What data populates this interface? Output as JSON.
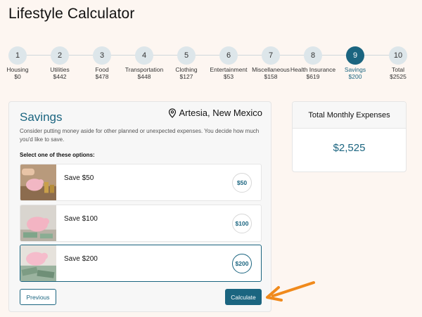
{
  "page": {
    "title": "Lifestyle Calculator"
  },
  "steps": [
    {
      "num": "1",
      "name": "Housing",
      "value": "$0"
    },
    {
      "num": "2",
      "name": "Utilities",
      "value": "$442"
    },
    {
      "num": "3",
      "name": "Food",
      "value": "$478"
    },
    {
      "num": "4",
      "name": "Transportation",
      "value": "$448"
    },
    {
      "num": "5",
      "name": "Clothing",
      "value": "$127"
    },
    {
      "num": "6",
      "name": "Entertainment",
      "value": "$53"
    },
    {
      "num": "7",
      "name": "Miscellaneous",
      "value": "$158"
    },
    {
      "num": "8",
      "name": "Health Insurance",
      "value": "$619"
    },
    {
      "num": "9",
      "name": "Savings",
      "value": "$200"
    },
    {
      "num": "10",
      "name": "Total",
      "value": "$2525"
    }
  ],
  "active_step": 9,
  "card": {
    "title": "Savings",
    "location": "Artesia, New Mexico",
    "description": "Consider putting money aside for other planned or unexpected expenses. You decide how much you'd like to save.",
    "options_label": "Select one of these options:"
  },
  "options": [
    {
      "label": "Save $50",
      "badge": "$50",
      "selected": false
    },
    {
      "label": "Save $100",
      "badge": "$100",
      "selected": false
    },
    {
      "label": "Save $200",
      "badge": "$200",
      "selected": true
    }
  ],
  "buttons": {
    "previous": "Previous",
    "calculate": "Calculate"
  },
  "summary": {
    "title": "Total Monthly Expenses",
    "value": "$2,525"
  },
  "colors": {
    "accent": "#1b6580",
    "annotation_arrow": "#f08a1c",
    "background": "#fdf6f1"
  }
}
